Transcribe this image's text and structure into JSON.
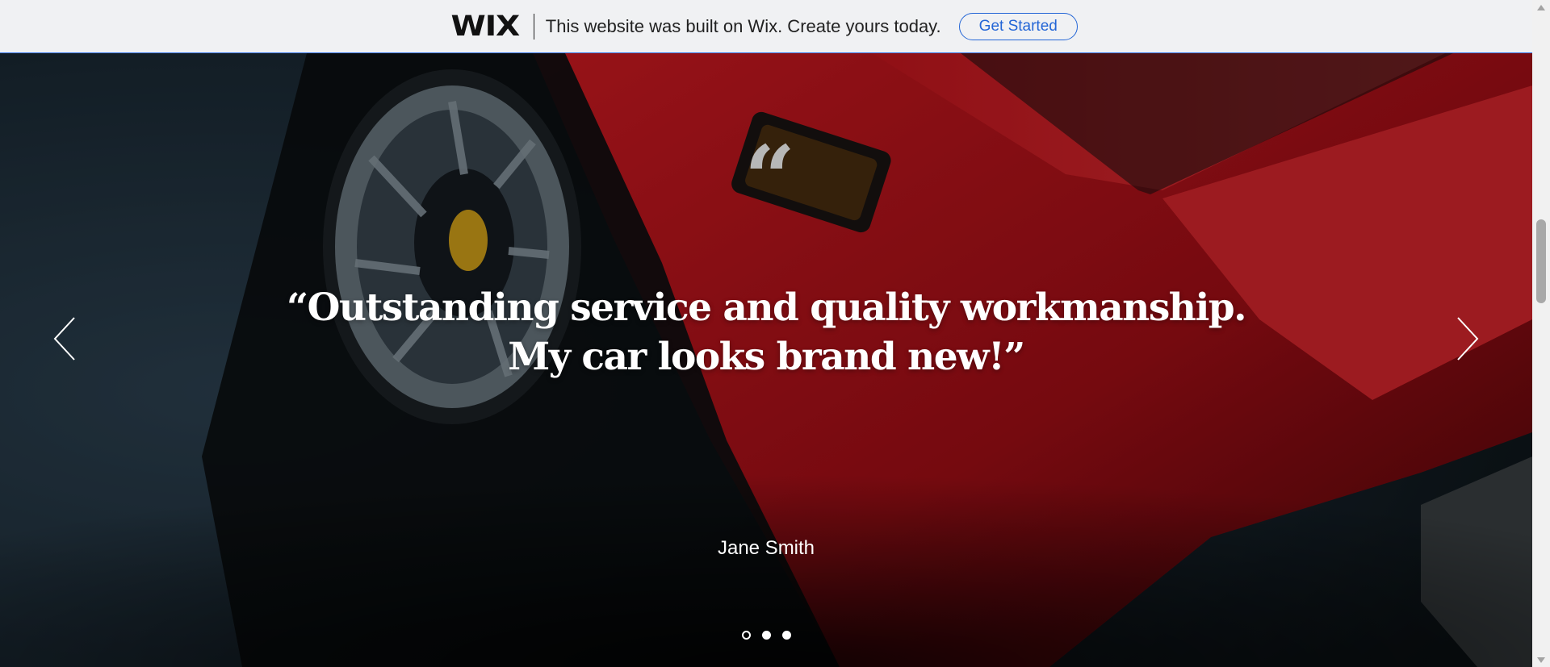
{
  "wix_banner": {
    "logo": "WIX",
    "message": "This website was built on Wix. Create yours today.",
    "cta_label": "Get Started"
  },
  "hero": {
    "quote_glyph": "“",
    "testimonial_line1": "“Outstanding service and quality workmanship.",
    "testimonial_line2": "My car looks brand new!”",
    "author": "Jane Smith",
    "slides": [
      {
        "active": true
      },
      {
        "active": false
      },
      {
        "active": false
      }
    ]
  },
  "colors": {
    "banner_bg": "#f0f1f3",
    "cta_accent": "#2466d6",
    "car_red": "#c8161e",
    "quote_mark": "#b7b7b7"
  },
  "icons": {
    "prev": "chevron-left-icon",
    "next": "chevron-right-icon"
  }
}
